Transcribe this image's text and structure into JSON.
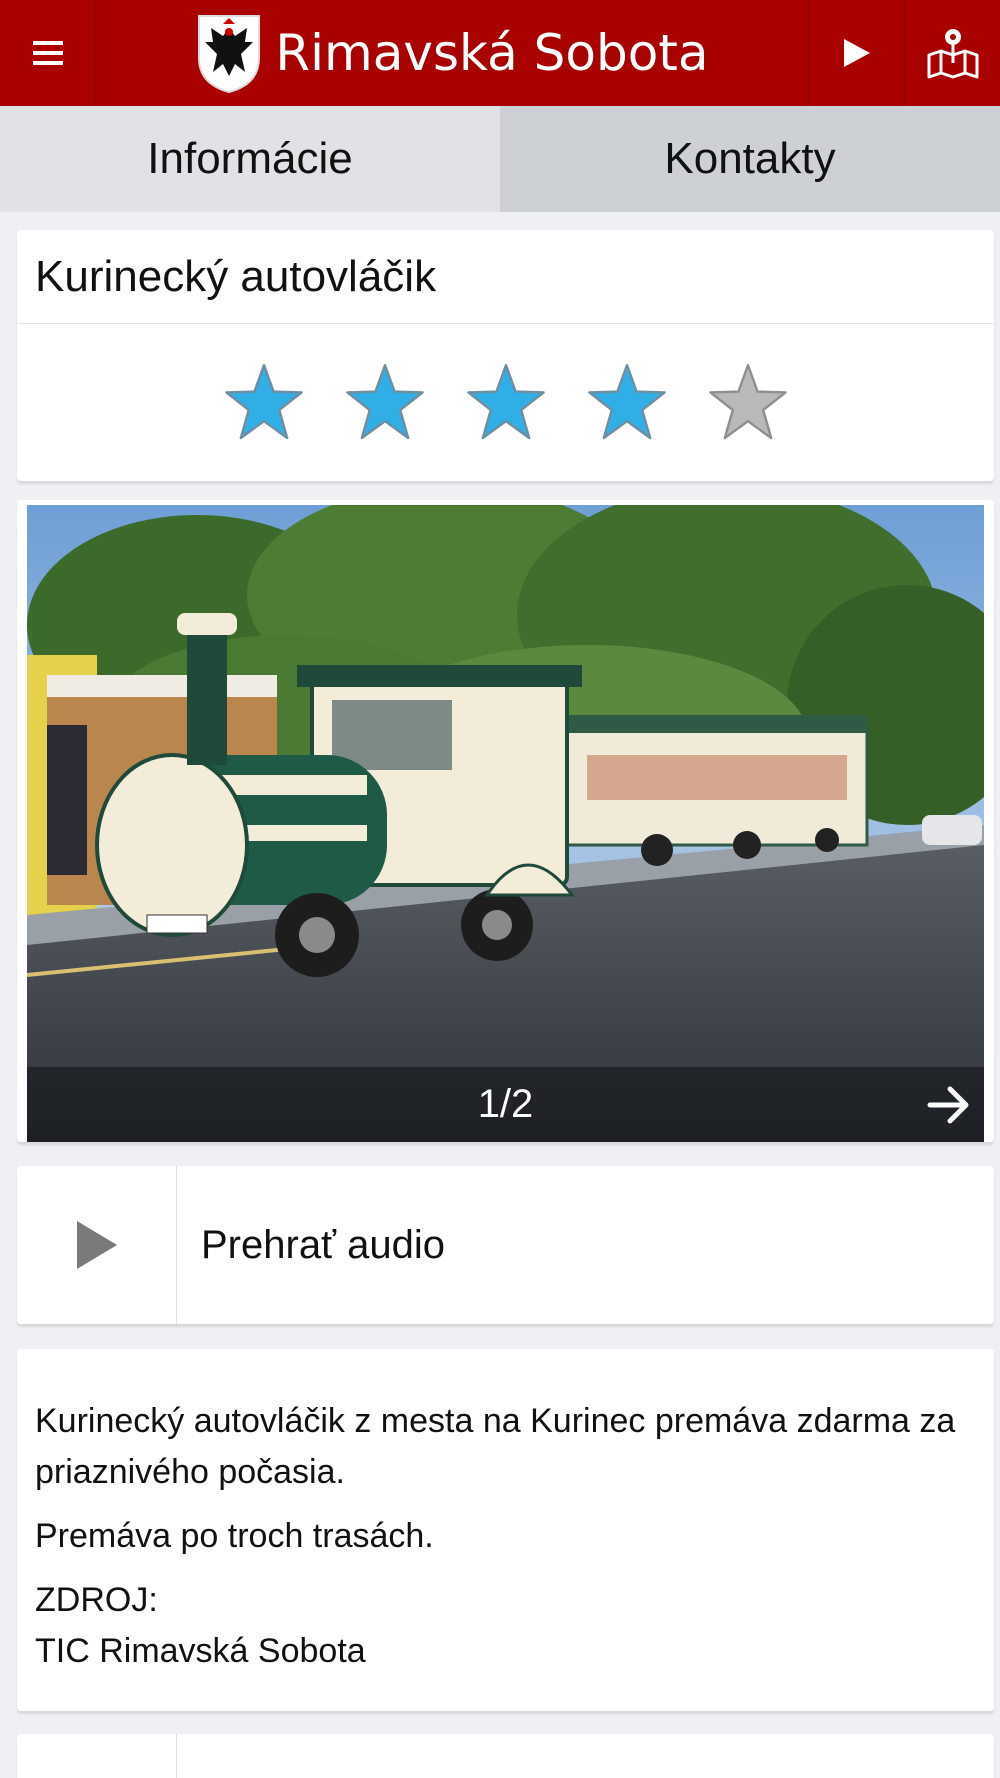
{
  "header": {
    "title": "Rimavská Sobota",
    "menu_icon": "hamburger-menu-icon",
    "play_icon": "play-icon",
    "map_icon": "map-pin-icon",
    "background": "#a90000"
  },
  "tabs": [
    {
      "label": "Informácie",
      "active": true
    },
    {
      "label": "Kontakty",
      "active": false
    }
  ],
  "attraction": {
    "title": "Kurinecký autovláčik",
    "rating": {
      "value": 4,
      "max": 5
    },
    "star_colors": {
      "filled": "#30aee6",
      "empty": "#b9b9b9"
    }
  },
  "gallery": {
    "counter": "1/2",
    "next_icon": "arrow-right-icon"
  },
  "audio": {
    "label": "Prehrať audio",
    "icon": "play-icon"
  },
  "description": {
    "paragraphs": [
      "Kurinecký autovláčik  z mesta na Kurinec premáva zdarma za priaznivého počasia.",
      "Premáva po troch trasách."
    ],
    "source_label": "ZDROJ:",
    "source_value": "TIC Rimavská Sobota"
  }
}
